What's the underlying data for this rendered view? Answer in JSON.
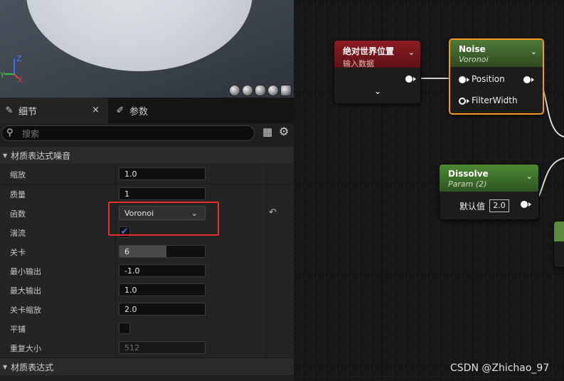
{
  "viewport": {
    "axis_z": "Z",
    "axis_y": "Y",
    "axis_x": "X"
  },
  "tabs": {
    "details": "细节",
    "params": "参数",
    "close": "×"
  },
  "search": {
    "placeholder": "搜索"
  },
  "sections": {
    "noise": "材质表达式噪音",
    "expression": "材质表达式"
  },
  "properties": [
    {
      "label": "缩放",
      "value": "1.0"
    },
    {
      "label": "质量",
      "value": "1"
    },
    {
      "label": "函数",
      "value": "Voronoi"
    },
    {
      "label": "湍流",
      "checked": true
    },
    {
      "label": "关卡",
      "value": "6",
      "slider_fraction": 0.55
    },
    {
      "label": "最小输出",
      "value": "-1.0"
    },
    {
      "label": "最大输出",
      "value": "1.0"
    },
    {
      "label": "关卡缩放",
      "value": "2.0"
    },
    {
      "label": "平铺",
      "checked": false
    },
    {
      "label": "重复大小",
      "value": "512"
    }
  ],
  "nodes": {
    "world_pos": {
      "title": "绝对世界位置",
      "subtitle": "输入数据",
      "color": "#8a1c22"
    },
    "noise": {
      "title": "Noise",
      "subtitle": "Voronoi",
      "color": "#4f7a38",
      "pins": [
        "Position",
        "FilterWidth"
      ],
      "selection": "#f39a1b"
    },
    "dissolve": {
      "title": "Dissolve",
      "subtitle": "Param (2)",
      "color": "#4d8a34",
      "pin_label": "默认值",
      "pin_value": "2.0"
    }
  },
  "watermark": "CSDN @Zhichao_97",
  "colors": {
    "highlight": "#e62e2e",
    "check": "#3f7be0"
  }
}
